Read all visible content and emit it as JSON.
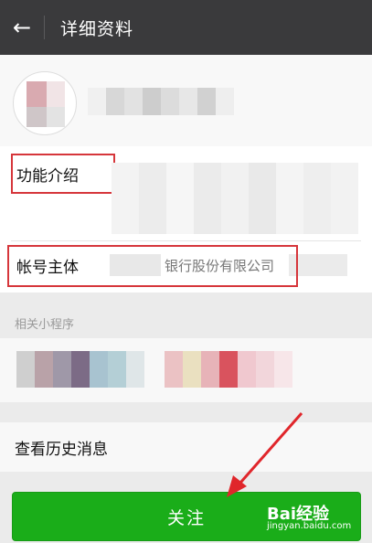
{
  "header": {
    "back_icon": "arrow-left-icon",
    "title": "详细资料",
    "background": "#3a3a3c"
  },
  "profile": {
    "avatar_colors": [
      "#d9aab0",
      "#f1e4e6",
      "#cfc6c8",
      "#e3e3e3"
    ],
    "name_blur_colors": [
      "#f0f0f0",
      "#d7d7d7",
      "#e2e2e2",
      "#cdcdcd",
      "#dcdcdc",
      "#e7e7e7",
      "#d1d1d1",
      "#eeeeee"
    ]
  },
  "info": {
    "intro_label": "功能介绍",
    "owner_label": "帐号主体",
    "owner_value": "银行股份有限公司",
    "highlight_color": "#d6363b",
    "intro_blur_colors": [
      "#f3f3f3",
      "#ececec",
      "#f6f6f6",
      "#ebebeb",
      "#f1f1f1",
      "#e9e9e9",
      "#f4f4f4",
      "#eeeeee",
      "#f2f2f2"
    ]
  },
  "mini_programs": {
    "section_label": "相关小程序",
    "blur_colors_left": [
      "#cfcfcf",
      "#b9a2a8",
      "#9f98a8",
      "#7c6b86",
      "#a8c3d0",
      "#b4cfd6",
      "#dfe6e8"
    ],
    "blur_colors_right": [
      "#ebc2c4",
      "#eae0c0",
      "#e7b3b8",
      "#d9535e",
      "#f0c8cf",
      "#f2d6db",
      "#f7e6e9"
    ]
  },
  "history": {
    "label": "查看历史消息"
  },
  "follow_button": {
    "label": "关注",
    "color": "#1aad19"
  },
  "watermark": {
    "logo": "Bai经验",
    "url": "jingyan.baidu.com"
  },
  "annotation_arrow_color": "#e0262b"
}
